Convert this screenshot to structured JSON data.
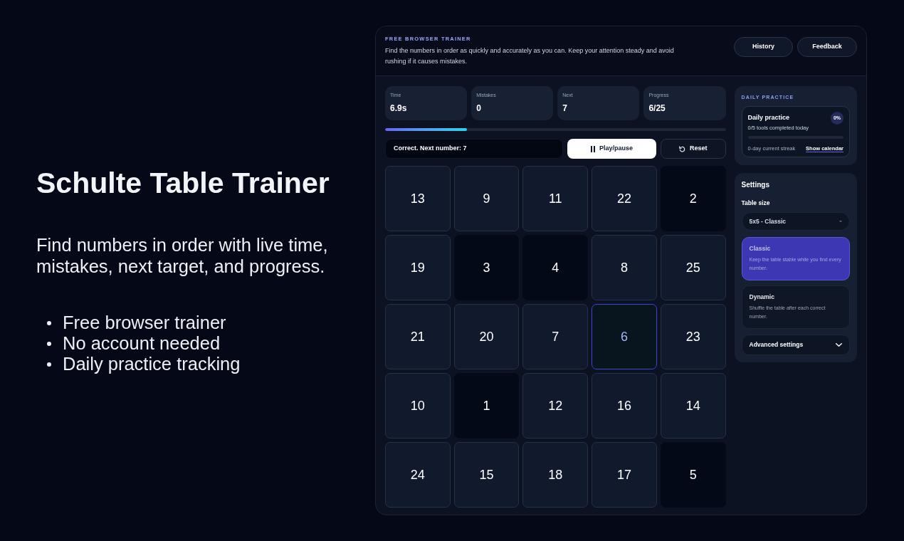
{
  "hero": {
    "title": "Schulte Table Trainer",
    "description": "Find numbers in order with live time, mistakes, next target, and progress.",
    "features": [
      "Free browser trainer",
      "No account needed",
      "Daily practice tracking"
    ]
  },
  "app": {
    "header": {
      "eyebrow": "FREE BROWSER TRAINER",
      "description": "Find the numbers in order as quickly and accurately as you can. Keep your attention steady and avoid rushing if it causes mistakes.",
      "buttons": [
        "History",
        "Feedback"
      ]
    },
    "stats": [
      {
        "label": "Time",
        "value": "6.9s"
      },
      {
        "label": "Mistakes",
        "value": "0"
      },
      {
        "label": "Next",
        "value": "7"
      },
      {
        "label": "Progress",
        "value": "6/25"
      }
    ],
    "progress": {
      "level": 0.24
    },
    "status_message": "Correct. Next number: 7",
    "controls": [
      {
        "kind": "play",
        "label": "Play/pause"
      },
      {
        "kind": "reset",
        "label": "Reset"
      }
    ],
    "grid": {
      "cells": [
        {
          "number": "13",
          "found": false,
          "selected": false
        },
        {
          "number": "9",
          "found": false,
          "selected": false
        },
        {
          "number": "11",
          "found": false,
          "selected": false
        },
        {
          "number": "22",
          "found": false,
          "selected": false
        },
        {
          "number": "2",
          "found": true,
          "selected": false
        },
        {
          "number": "19",
          "found": false,
          "selected": false
        },
        {
          "number": "3",
          "found": true,
          "selected": false
        },
        {
          "number": "4",
          "found": true,
          "selected": false
        },
        {
          "number": "8",
          "found": false,
          "selected": false
        },
        {
          "number": "25",
          "found": false,
          "selected": false
        },
        {
          "number": "21",
          "found": false,
          "selected": false
        },
        {
          "number": "20",
          "found": false,
          "selected": false
        },
        {
          "number": "7",
          "found": false,
          "selected": false
        },
        {
          "number": "6",
          "found": true,
          "selected": true
        },
        {
          "number": "23",
          "found": false,
          "selected": false
        },
        {
          "number": "10",
          "found": false,
          "selected": false
        },
        {
          "number": "1",
          "found": true,
          "selected": false
        },
        {
          "number": "12",
          "found": false,
          "selected": false
        },
        {
          "number": "16",
          "found": false,
          "selected": false
        },
        {
          "number": "14",
          "found": false,
          "selected": false
        },
        {
          "number": "24",
          "found": false,
          "selected": false
        },
        {
          "number": "15",
          "found": false,
          "selected": false
        },
        {
          "number": "18",
          "found": false,
          "selected": false
        },
        {
          "number": "17",
          "found": false,
          "selected": false
        },
        {
          "number": "5",
          "found": true,
          "selected": false
        }
      ]
    },
    "daily_practice": {
      "heading": "DAILY PRACTICE",
      "title": "Daily practice",
      "badge": "0%",
      "summary": "0/5 tools completed today",
      "level": 0,
      "streak": "0-day current streak",
      "link": "Show calendar"
    },
    "settings": {
      "title": "Settings",
      "table_size_label": "Table size",
      "table_size": "5x5 - Classic",
      "modes": [
        {
          "name": "Classic",
          "description": "Keep the table stable while you find every number.",
          "selected": true
        },
        {
          "name": "Dynamic",
          "description": "Shuffle the table after each correct number.",
          "selected": false
        }
      ],
      "advanced": {
        "label": "Advanced settings",
        "expanded": false
      }
    }
  }
}
